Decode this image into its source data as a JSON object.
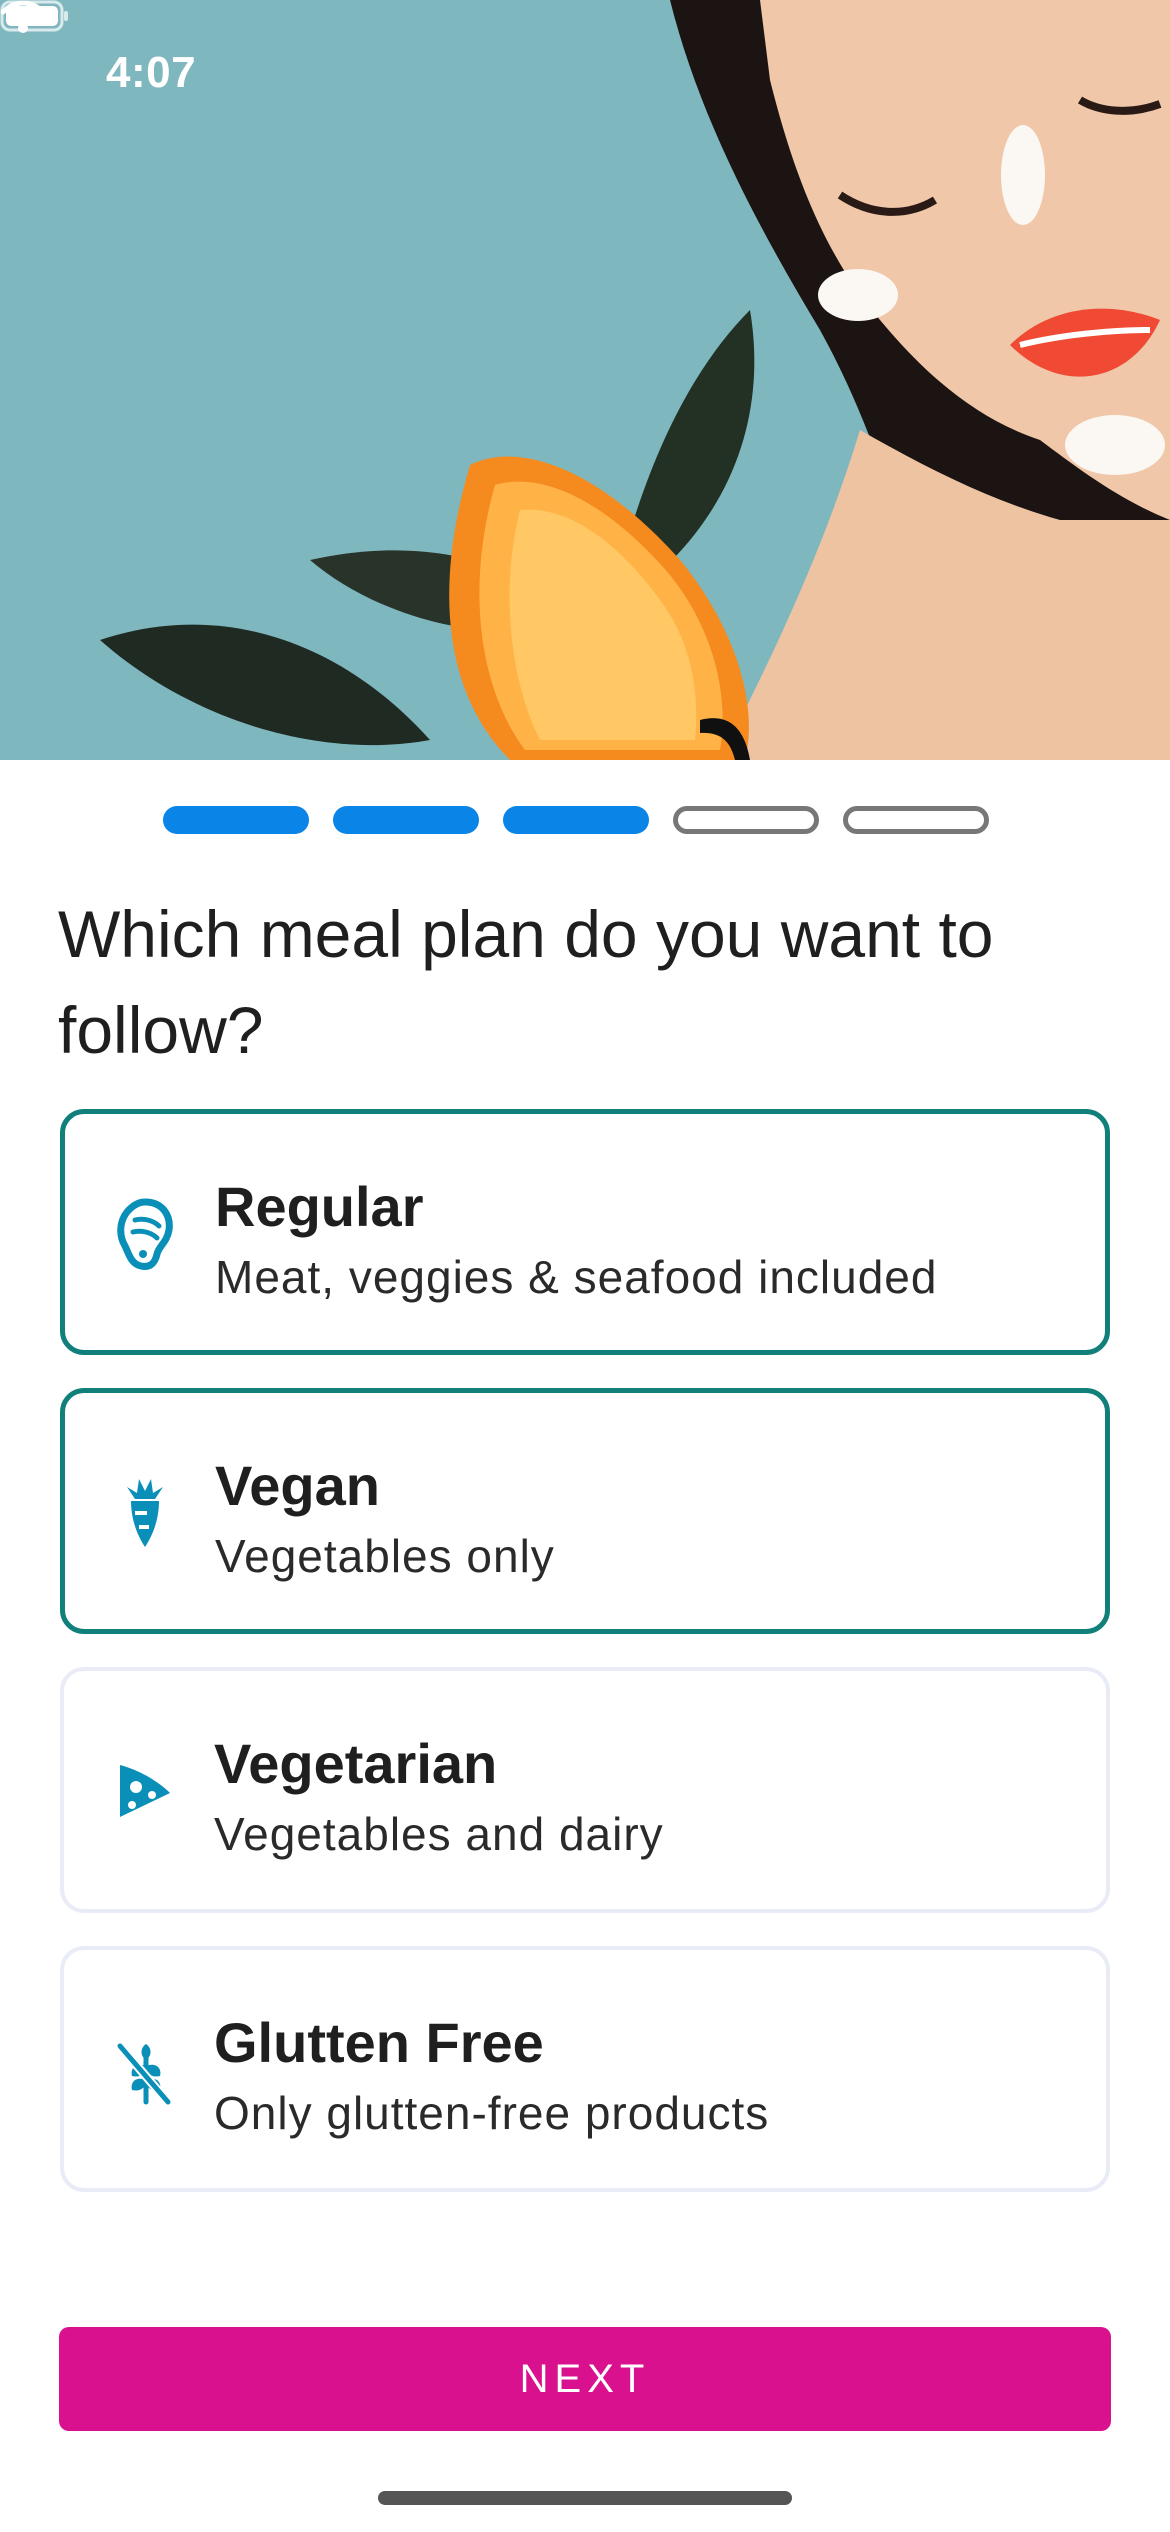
{
  "status_bar": {
    "time": "4:07"
  },
  "progress": {
    "total_steps": 5,
    "completed_steps": 3
  },
  "question": "Which meal plan do you want to follow?",
  "options": [
    {
      "title": "Regular",
      "subtitle": "Meat, veggies & seafood included",
      "icon": "meat-icon",
      "selected": true
    },
    {
      "title": "Vegan",
      "subtitle": "Vegetables only",
      "icon": "carrot-icon",
      "selected": true
    },
    {
      "title": "Vegetarian",
      "subtitle": "Vegetables and dairy",
      "icon": "cheese-icon",
      "selected": false
    },
    {
      "title": "Glutten Free",
      "subtitle": "Only glutten-free products",
      "icon": "no-wheat-icon",
      "selected": false
    }
  ],
  "next_button": {
    "label": "NEXT"
  },
  "colors": {
    "accent": "#d9118f",
    "progress_active": "#0a84e6",
    "selected_border": "#11807b",
    "icon": "#0a8fb8"
  }
}
